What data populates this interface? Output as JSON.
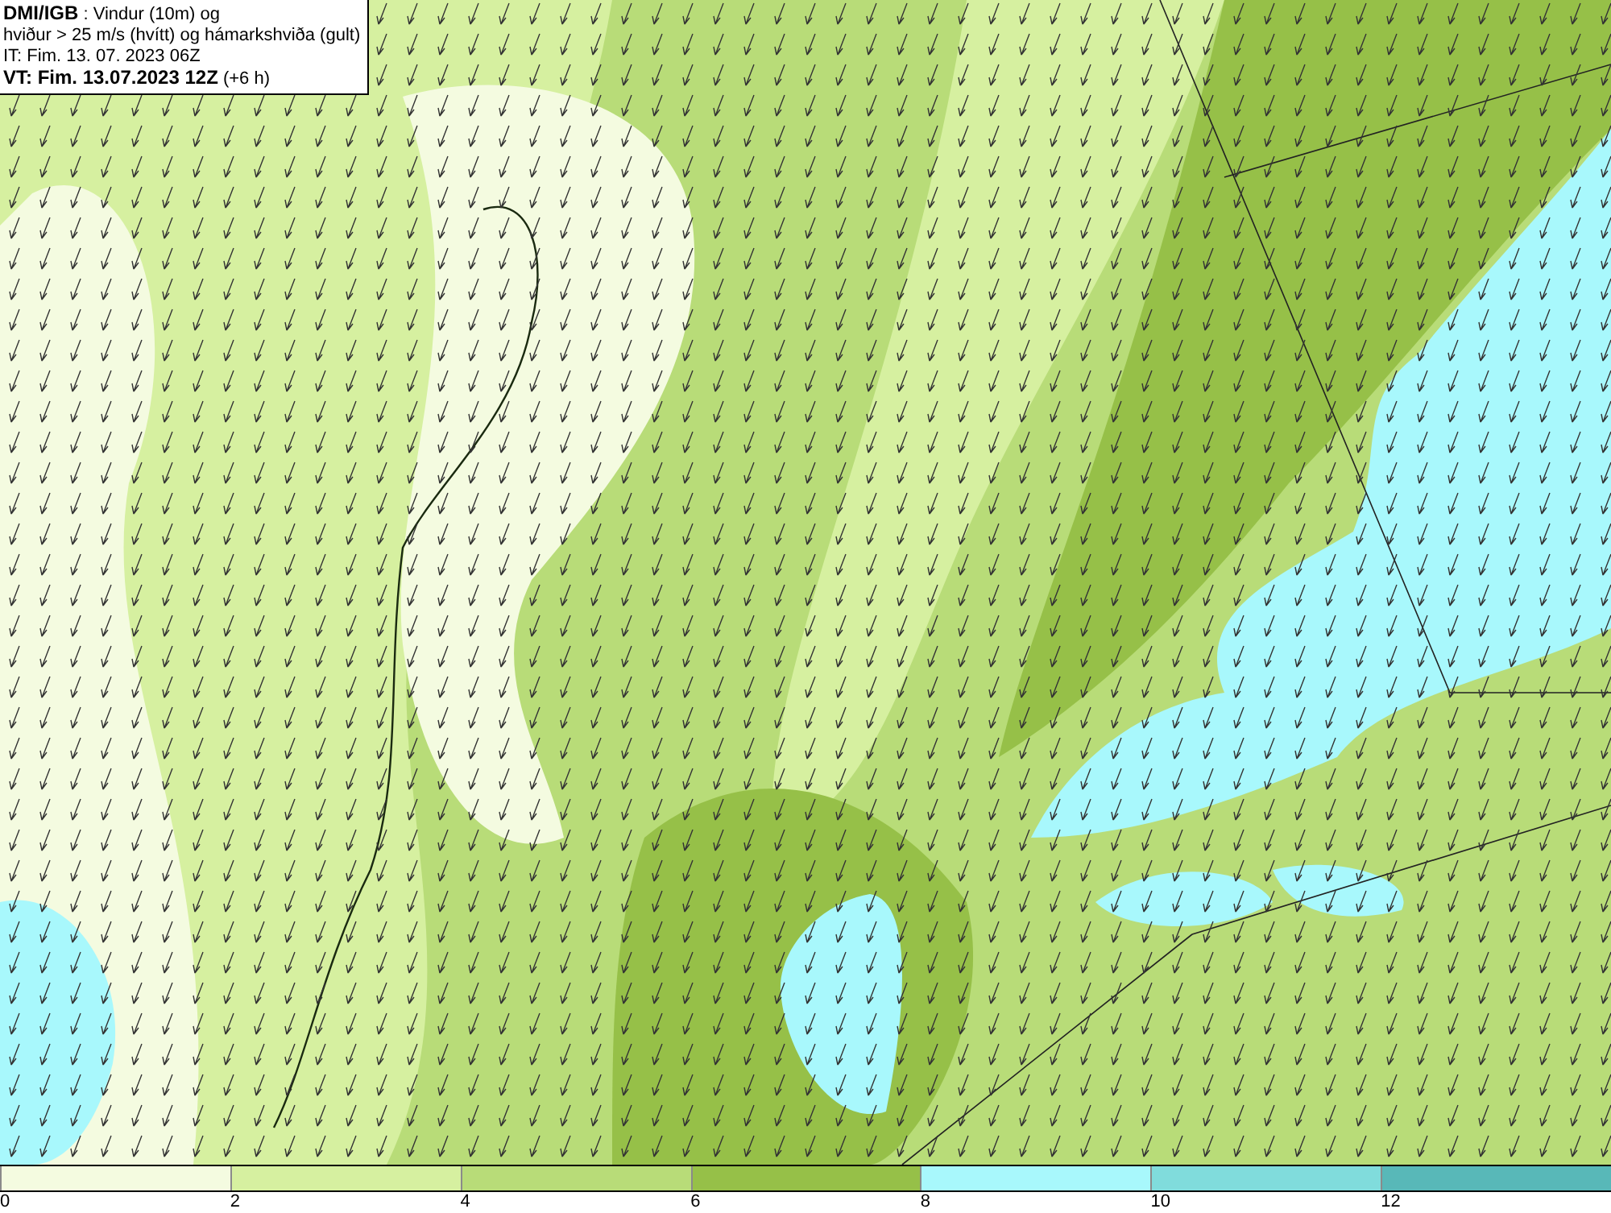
{
  "title_box": {
    "lines": [
      "**DMI/IGB** : Vindur (10m) og",
      "hviður > 25 m/s (hvítt) og hámarkshviða (gult)",
      "IT: Fim. 13. 07. 2023 06Z",
      "**VT: Fim. 13.07.2023 12Z** (+6 h)"
    ]
  },
  "legend": {
    "bins": [
      {
        "color": "#f4fbe0"
      },
      {
        "color": "#d6f0a0"
      },
      {
        "color": "#b8dc78"
      },
      {
        "color": "#96c048"
      },
      {
        "color": "#a8f8fc"
      },
      {
        "color": "#80dcdc"
      },
      {
        "color": "#58b8b8"
      }
    ],
    "ticks": [
      "0",
      "2",
      "4",
      "6",
      "8",
      "10",
      "12"
    ]
  }
}
